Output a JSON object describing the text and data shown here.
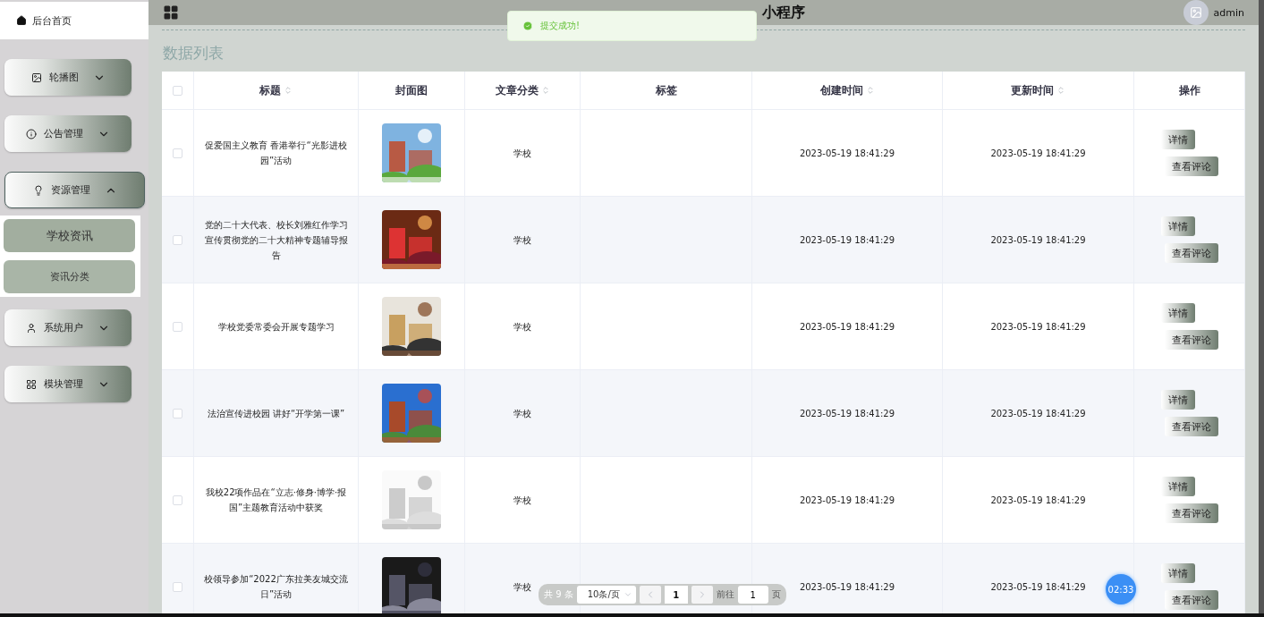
{
  "sidebar": {
    "home": {
      "label": "后台首页"
    },
    "items": [
      {
        "label": "轮播图",
        "expanded": false
      },
      {
        "label": "公告管理",
        "expanded": false
      },
      {
        "label": "资源管理",
        "expanded": true,
        "children": [
          {
            "label": "学校资讯",
            "selected": true
          },
          {
            "label": "资讯分类",
            "selected": false
          }
        ]
      },
      {
        "label": "系统用户",
        "expanded": false
      },
      {
        "label": "模块管理",
        "expanded": false
      }
    ]
  },
  "header": {
    "title": "小程序",
    "user": "admin"
  },
  "toast": {
    "message": "提交成功!"
  },
  "page_title": "数据列表",
  "table": {
    "select_all": {
      "checked": false
    },
    "columns": [
      {
        "label": "标题",
        "sortable": true
      },
      {
        "label": "封面图",
        "sortable": false
      },
      {
        "label": "文章分类",
        "sortable": true
      },
      {
        "label": "标签",
        "sortable": false
      },
      {
        "label": "创建时间",
        "sortable": true
      },
      {
        "label": "更新时间",
        "sortable": true
      },
      {
        "label": "操作",
        "sortable": false
      }
    ],
    "rows": [
      {
        "checked": false,
        "title": "促爱国主义教育 香港举行“光影进校园”活动",
        "category": "学校",
        "created": "2023-05-19 18:41:29",
        "updated": "2023-05-19 18:41:29",
        "actions": [
          "详情",
          "查看评论"
        ]
      },
      {
        "checked": false,
        "title": "党的二十大代表、校长刘雅红作学习宣传贯彻党的二十大精神专题辅导报告",
        "category": "学校",
        "created": "2023-05-19 18:41:29",
        "updated": "2023-05-19 18:41:29",
        "actions": [
          "详情",
          "查看评论"
        ]
      },
      {
        "checked": false,
        "title": "学校党委常委会开展专题学习",
        "category": "学校",
        "created": "2023-05-19 18:41:29",
        "updated": "2023-05-19 18:41:29",
        "actions": [
          "详情",
          "查看评论"
        ]
      },
      {
        "checked": false,
        "title": "法治宣传进校园 讲好“开学第一课”",
        "category": "学校",
        "created": "2023-05-19 18:41:29",
        "updated": "2023-05-19 18:41:29",
        "actions": [
          "详情",
          "查看评论"
        ]
      },
      {
        "checked": false,
        "title": "我校22项作品在“立志·修身·博学·报国”主题教育活动中获奖",
        "category": "学校",
        "created": "2023-05-19 18:41:29",
        "updated": "2023-05-19 18:41:29",
        "actions": [
          "详情",
          "查看评论"
        ]
      },
      {
        "checked": false,
        "title": "校领导参加“2022广东拉美友城交流日”活动",
        "category": "学校",
        "created": "2023-05-19 18:41:29",
        "updated": "2023-05-19 18:41:29",
        "actions": [
          "详情",
          "查看评论"
        ]
      }
    ]
  },
  "pagination": {
    "total": "共 9 条",
    "page_size": "10条/页",
    "current": "1",
    "goto_label": "前往",
    "goto_value": "1",
    "goto_suffix": "页"
  },
  "timer": "02:33"
}
